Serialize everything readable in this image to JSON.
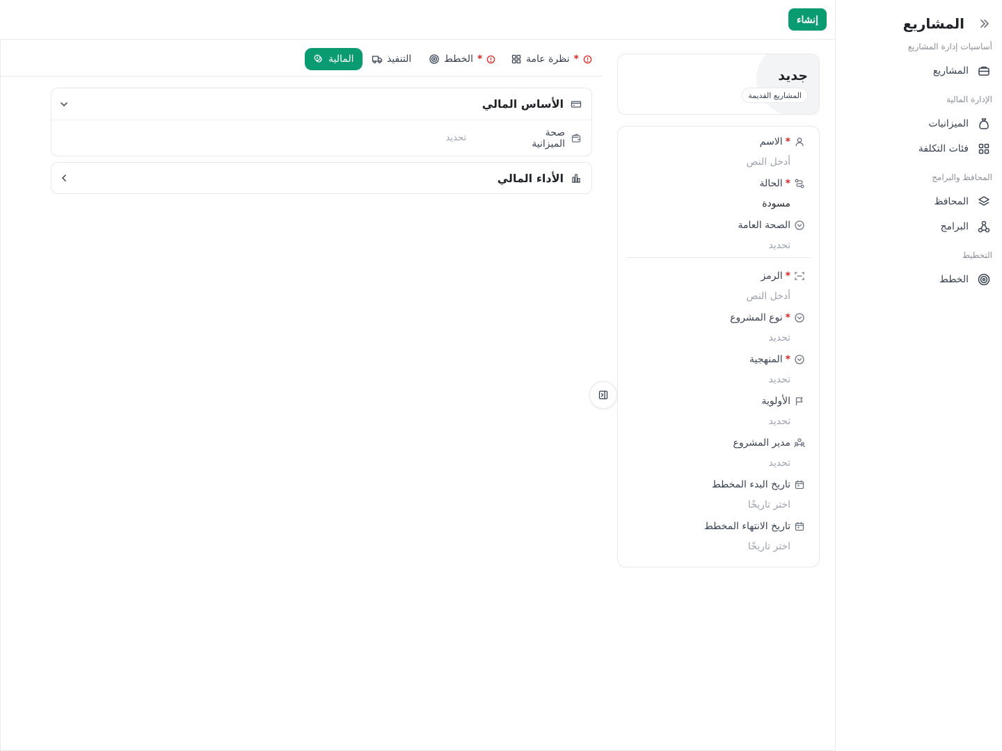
{
  "app": {
    "title": "المشاريع",
    "create_label": "إنشاء"
  },
  "sidebar": {
    "groups": [
      {
        "label": "أساسيات إدارة المشاريع"
      },
      {
        "label": "الإدارة المالية"
      },
      {
        "label": "المحافظ والبرامج"
      },
      {
        "label": "التخطيط"
      }
    ],
    "items": [
      {
        "label": "المشاريع",
        "icon": "briefcase-icon"
      },
      {
        "label": "الميزانيات",
        "icon": "money-bag-icon"
      },
      {
        "label": "فئات التكلفة",
        "icon": "grid-icon"
      },
      {
        "label": "المحافظ",
        "icon": "layers-icon"
      },
      {
        "label": "البرامج",
        "icon": "hierarchy-icon"
      },
      {
        "label": "الخطط",
        "icon": "target-icon"
      }
    ]
  },
  "tabs": [
    {
      "label": "نظرة عامة",
      "required": "*",
      "icon": "grid-icon",
      "warning": true
    },
    {
      "label": "الخطط",
      "required": "*",
      "icon": "target-icon",
      "warning": true
    },
    {
      "label": "التنفيذ",
      "icon": "truck-icon"
    },
    {
      "label": "المالية",
      "icon": "coins-icon",
      "active": true
    }
  ],
  "sections": [
    {
      "title": "الأساس المالي",
      "icon": "banknote-icon",
      "expanded": true,
      "rows": [
        {
          "label": "صحة الميزانية",
          "value": "تحديد",
          "icon": "wallet-icon"
        }
      ]
    },
    {
      "title": "الأداء المالي",
      "icon": "bar-chart-icon",
      "expanded": false
    }
  ],
  "summary": {
    "title": "جديد",
    "chip": "المشاريع القديمة"
  },
  "fields": [
    {
      "label": "الاسم",
      "required": "*",
      "value": "أدخل النص",
      "icon": "user-icon"
    },
    {
      "label": "الحالة",
      "required": "*",
      "value": "مسودة",
      "filled": true,
      "icon": "status-route-icon"
    },
    {
      "label": "الصحة العامة",
      "value": "تحديد",
      "icon": "chevron-circle-icon"
    },
    {
      "label": "الرمز",
      "required": "*",
      "value": "أدخل النص",
      "icon": "code-scan-icon"
    },
    {
      "label": "نوع المشروع",
      "required": "*",
      "value": "تحديد",
      "icon": "chevron-circle-icon"
    },
    {
      "label": "المنهجية",
      "required": "*",
      "value": "تحديد",
      "icon": "chevron-circle-icon"
    },
    {
      "label": "الأولوية",
      "value": "تحديد",
      "icon": "flag-icon"
    },
    {
      "label": "مدير المشروع",
      "value": "تحديد",
      "icon": "users-icon"
    },
    {
      "label": "تاريخ البدء المخطط",
      "value": "اختر تاريخًا",
      "icon": "calendar-icon"
    },
    {
      "label": "تاريخ الانتهاء المخطط",
      "value": "اختر تاريخًا",
      "icon": "calendar-icon"
    }
  ],
  "colors": {
    "accent": "#0a9b73",
    "required": "#dc2626",
    "border": "#e6e8eb"
  }
}
